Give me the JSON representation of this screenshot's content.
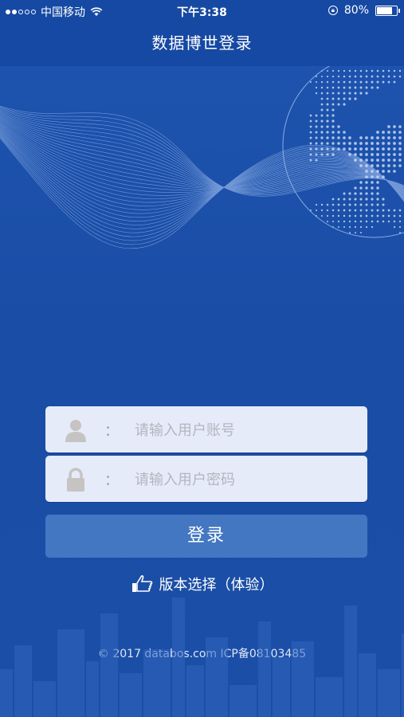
{
  "status_bar": {
    "carrier": "中国移动",
    "time": "下午3:38",
    "battery_percent": "80%",
    "battery_level": 0.8
  },
  "nav": {
    "title": "数据博世登录"
  },
  "form": {
    "username_placeholder": "请输入用户账号",
    "password_placeholder": "请输入用户密码",
    "colon": "：",
    "login_label": "登录"
  },
  "version_link": {
    "label": "版本选择（体验）"
  },
  "footer": {
    "copyright": "© 2017 databos.com ICP备08103485"
  },
  "colors": {
    "background": "#1b4ea7",
    "navbar": "#1649a3",
    "field": "#e6ebfa",
    "button": "#4377c2"
  },
  "icons": [
    "signal-dots-icon",
    "wifi-icon",
    "orientation-lock-icon",
    "battery-icon",
    "user-icon",
    "lock-icon",
    "thumb-pointer-icon"
  ]
}
